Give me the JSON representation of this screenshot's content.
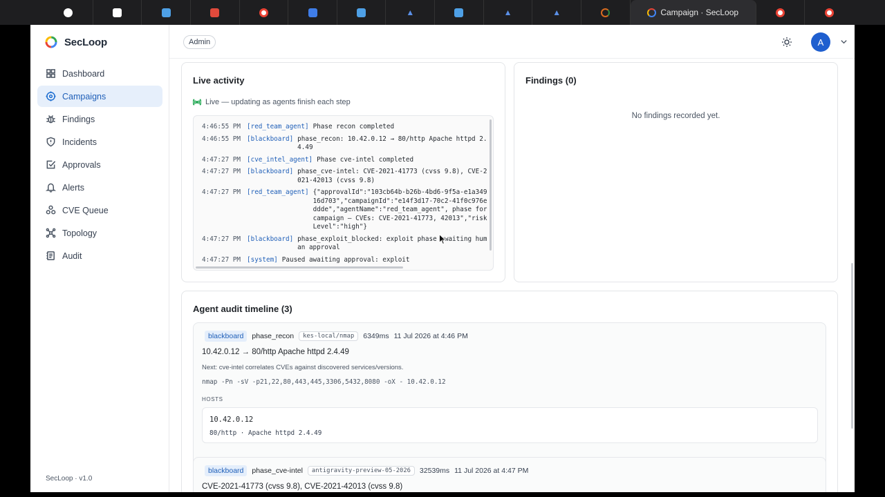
{
  "browser": {
    "tabs": [
      {
        "icon": "github-icon",
        "color": "#ffffff"
      },
      {
        "icon": "app-icon",
        "color": "#ffffff"
      },
      {
        "icon": "s-app-icon",
        "color": "#4ea0e6"
      },
      {
        "icon": "gmail-icon",
        "color": "#e04a3c"
      },
      {
        "icon": "google-icon",
        "color": "#ffffff"
      },
      {
        "icon": "docs-icon",
        "color": "#3f7de8"
      },
      {
        "icon": "s-app-icon",
        "color": "#4ea0e6"
      },
      {
        "icon": "a-app-icon",
        "color": "#5a8fe6"
      },
      {
        "icon": "s-app-icon",
        "color": "#4ea0e6"
      },
      {
        "icon": "a-app-icon",
        "color": "#5a8fe6"
      },
      {
        "icon": "a-app-icon",
        "color": "#5a8fe6"
      },
      {
        "icon": "loading-icon",
        "color": "#d96b1f"
      }
    ],
    "active_tab_title": "Campaign · SecLoop"
  },
  "brand": {
    "name": "SecLoop"
  },
  "sidebar": {
    "items": [
      {
        "label": "Dashboard",
        "icon": "grid-icon",
        "active": false
      },
      {
        "label": "Campaigns",
        "icon": "target-icon",
        "active": true
      },
      {
        "label": "Findings",
        "icon": "bug-icon",
        "active": false
      },
      {
        "label": "Incidents",
        "icon": "shield-icon",
        "active": false
      },
      {
        "label": "Approvals",
        "icon": "check-square-icon",
        "active": false
      },
      {
        "label": "Alerts",
        "icon": "bell-icon",
        "active": false
      },
      {
        "label": "CVE Queue",
        "icon": "nodes-icon",
        "active": false
      },
      {
        "label": "Topology",
        "icon": "topology-icon",
        "active": false
      },
      {
        "label": "Audit",
        "icon": "audit-icon",
        "active": false
      }
    ],
    "version": "SecLoop · v1.0"
  },
  "topbar": {
    "role": "Admin",
    "avatar_initial": "A"
  },
  "live": {
    "title": "Live activity",
    "status": "Live — updating as agents finish each step",
    "log": [
      {
        "time": "4:46:55 PM",
        "agent": "[red_team_agent]",
        "message": "Phase recon completed"
      },
      {
        "time": "4:46:55 PM",
        "agent": "[blackboard]",
        "message": "phase_recon: 10.42.0.12 → 80/http Apache httpd 2.4.49"
      },
      {
        "time": "4:47:27 PM",
        "agent": "[cve_intel_agent]",
        "message": "Phase cve-intel completed"
      },
      {
        "time": "4:47:27 PM",
        "agent": "[blackboard]",
        "message": "phase_cve-intel: CVE-2021-41773 (cvss 9.8), CVE-2021-42013 (cvss 9.8)"
      },
      {
        "time": "4:47:27 PM",
        "agent": "[red_team_agent]",
        "message": "{\"approvalId\":\"103cb64b-b26b-4bd6-9f5a-e1a34916d703\",\"campaignId\":\"e14f3d17-70c2-41f0c976eddde\",\"agentName\":\"red_team_agent\", phase for campaign — CVEs: CVE-2021-41773, 42013\",\"riskLevel\":\"high\"}"
      },
      {
        "time": "4:47:27 PM",
        "agent": "[blackboard]",
        "message": "phase_exploit_blocked: exploit phase awaiting human approval"
      },
      {
        "time": "4:47:27 PM",
        "agent": "[system]",
        "message": "Paused awaiting approval: exploit"
      }
    ]
  },
  "findings": {
    "title": "Findings (0)",
    "empty": "No findings recorded yet."
  },
  "timeline": {
    "title": "Agent audit timeline (3)",
    "entries": [
      {
        "source": "blackboard",
        "phase": "phase_recon",
        "tool": "kes-local/nmap",
        "duration": "6349ms",
        "timestamp": "11 Jul 2026 at 4:46 PM",
        "summary": "10.42.0.12 → 80/http Apache httpd 2.4.49",
        "next": "Next: cve-intel correlates CVEs against discovered services/versions.",
        "command": "nmap -Pn -sV -p21,22,80,443,445,3306,5432,8080 -oX - 10.42.0.12",
        "hosts_label": "HOSTS",
        "host": {
          "ip": "10.42.0.12",
          "service": "80/http · Apache httpd 2.4.49"
        }
      },
      {
        "source": "blackboard",
        "phase": "phase_cve-intel",
        "tool": "antigravity-preview-05-2026",
        "duration": "32539ms",
        "timestamp": "11 Jul 2026 at 4:47 PM",
        "summary": "CVE-2021-41773 (cvss 9.8), CVE-2021-42013 (cvss 9.8)"
      }
    ]
  },
  "colors": {
    "accent": "#1f5fcf",
    "live": "#16a34a",
    "active_nav_bg": "#e6effb"
  }
}
